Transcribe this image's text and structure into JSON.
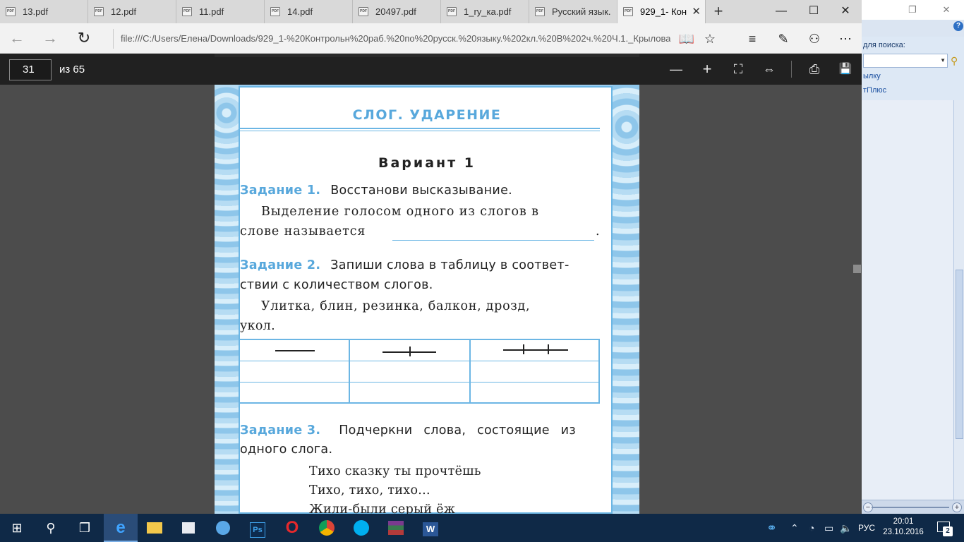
{
  "browser": {
    "tabs": [
      {
        "label": "13.pdf",
        "active": false
      },
      {
        "label": "12.pdf",
        "active": false
      },
      {
        "label": "11.pdf",
        "active": false
      },
      {
        "label": "14.pdf",
        "active": false
      },
      {
        "label": "20497.pdf",
        "active": false
      },
      {
        "label": "1_ry_ка.pdf",
        "active": false
      },
      {
        "label": "Русский язык.",
        "active": false
      },
      {
        "label": "929_1- Кон",
        "active": true
      }
    ],
    "tab_icon_text": "PDF",
    "tab_close_glyph": "✕",
    "new_tab_glyph": "+",
    "window_controls": {
      "minimize": "—",
      "maximize": "☐",
      "close": "✕"
    },
    "nav": {
      "back": "←",
      "forward": "→",
      "refresh": "↻"
    },
    "url": "file:///C:/Users/Елена/Downloads/929_1-%20Контрольн%20раб.%20по%20русск.%20языку.%202кл.%20В%202ч.%20Ч.1._Крылова%2",
    "toolbar_icons": {
      "reading_view": "📖",
      "favorite": "☆",
      "hub": "≡",
      "web_note": "✎",
      "share": "⚇",
      "more": "⋯"
    }
  },
  "pdf_toolbar": {
    "page_current": "31",
    "page_total": "из 65",
    "zoom_out": "—",
    "zoom_in": "+",
    "fit_page": "⛶",
    "fit_width": "⇔",
    "print": "⎙",
    "save": "💾"
  },
  "document": {
    "title": "СЛОГ. УДАРЕНИЕ",
    "variant": "Вариант 1",
    "task1": {
      "label": "Задание 1.",
      "instruction": "Восстанови высказывание.",
      "line1": "Выделение голосом одного из слогов в",
      "line2": "слове называется",
      "end_punct": "."
    },
    "task2": {
      "label": "Задание 2.",
      "instruction_line1": "Запиши слова в таблицу в соответ-",
      "instruction_line2": "ствии с количеством слогов.",
      "words_line1": "Улитка, блин, резинка, балкон, дрозд,",
      "words_line2": "укол."
    },
    "task3": {
      "label": "Задание 3.",
      "instruction_line1": "Подчеркни слова, состоящие из",
      "instruction_line2": "одного слога.",
      "poem_line1": "Тихо сказку ты прочтёшь",
      "poem_line2": "Тихо, тихо, тихо...",
      "poem_line3": "Жили-были серый ёж"
    }
  },
  "background_window": {
    "search_label": "для поиска:",
    "link1": "ылку",
    "link2": "тПлюс",
    "help": "?",
    "controls": {
      "restore": "❐",
      "close": "✕"
    }
  },
  "taskbar": {
    "start": "⊞",
    "search": "⚲",
    "task_view": "❐",
    "apps": [
      "edge",
      "explorer",
      "store",
      "itunes",
      "photoshop",
      "opera",
      "chrome",
      "skype",
      "winrar",
      "word"
    ],
    "app_labels": {
      "photoshop": "Ps",
      "word": "W",
      "edge": "e",
      "opera": "O"
    },
    "tray": {
      "language": "РУС",
      "time": "20:01",
      "date": "23.10.2016",
      "notification_count": "2"
    }
  }
}
